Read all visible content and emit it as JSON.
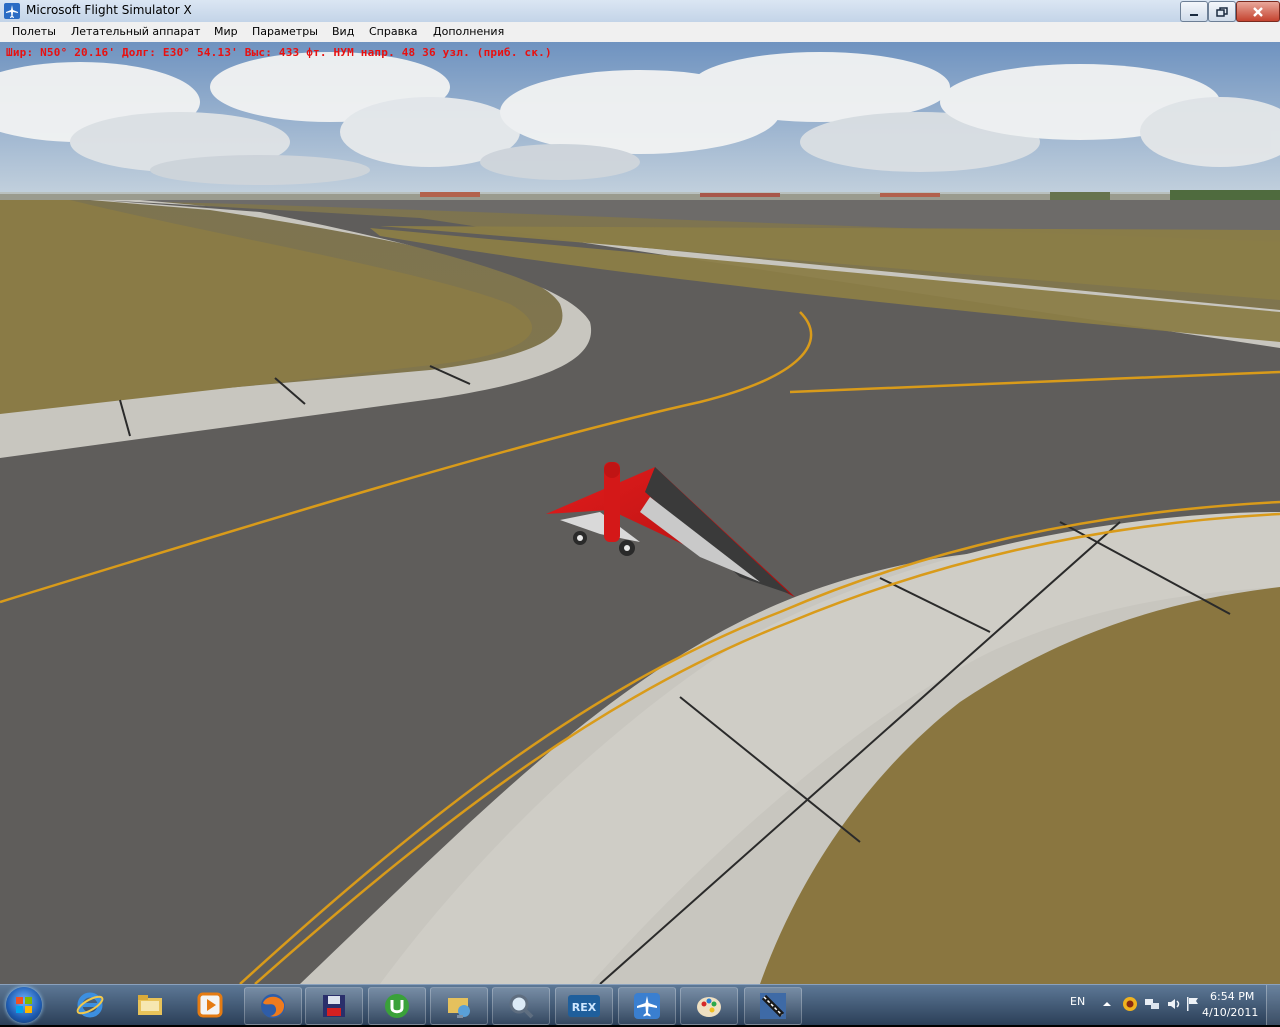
{
  "window": {
    "title": "Microsoft Flight Simulator X",
    "controls": [
      "minimize",
      "maximize",
      "close"
    ]
  },
  "menu": {
    "items": [
      {
        "label": "Полеты"
      },
      {
        "label": "Летательный аппарат"
      },
      {
        "label": "Мир"
      },
      {
        "label": "Параметры"
      },
      {
        "label": "Вид"
      },
      {
        "label": "Справка"
      },
      {
        "label": "Дополнения"
      }
    ]
  },
  "hud": {
    "text": "Шир: N50° 20.16'  Долг: E30° 54.13'  Выс: 433 фт. НУМ  напр. 48  36 узл. (приб. ск.)",
    "color": "#e81010"
  },
  "scene": {
    "sky_color": "#7fa2c9",
    "grass_color": "#8a7c4a",
    "asphalt_color": "#5f5d5b",
    "concrete_color": "#c9c7c0",
    "taxi_line_color": "#d79a1a",
    "aircraft_color": "#d41818"
  },
  "taskbar": {
    "start": "start-orb",
    "apps": [
      {
        "name": "internet-explorer-icon"
      },
      {
        "name": "folder-icon"
      },
      {
        "name": "media-player-icon"
      },
      {
        "name": "firefox-icon"
      },
      {
        "name": "save-disk-icon"
      },
      {
        "name": "utorrent-icon"
      },
      {
        "name": "network-folder-icon"
      },
      {
        "name": "magnifier-icon"
      },
      {
        "name": "rex-icon",
        "label": "REX"
      },
      {
        "name": "flight-simulator-icon"
      },
      {
        "name": "paint-icon"
      },
      {
        "name": "runway-tool-icon"
      }
    ],
    "language": "EN",
    "time": "6:54 PM",
    "date": "4/10/2011"
  }
}
